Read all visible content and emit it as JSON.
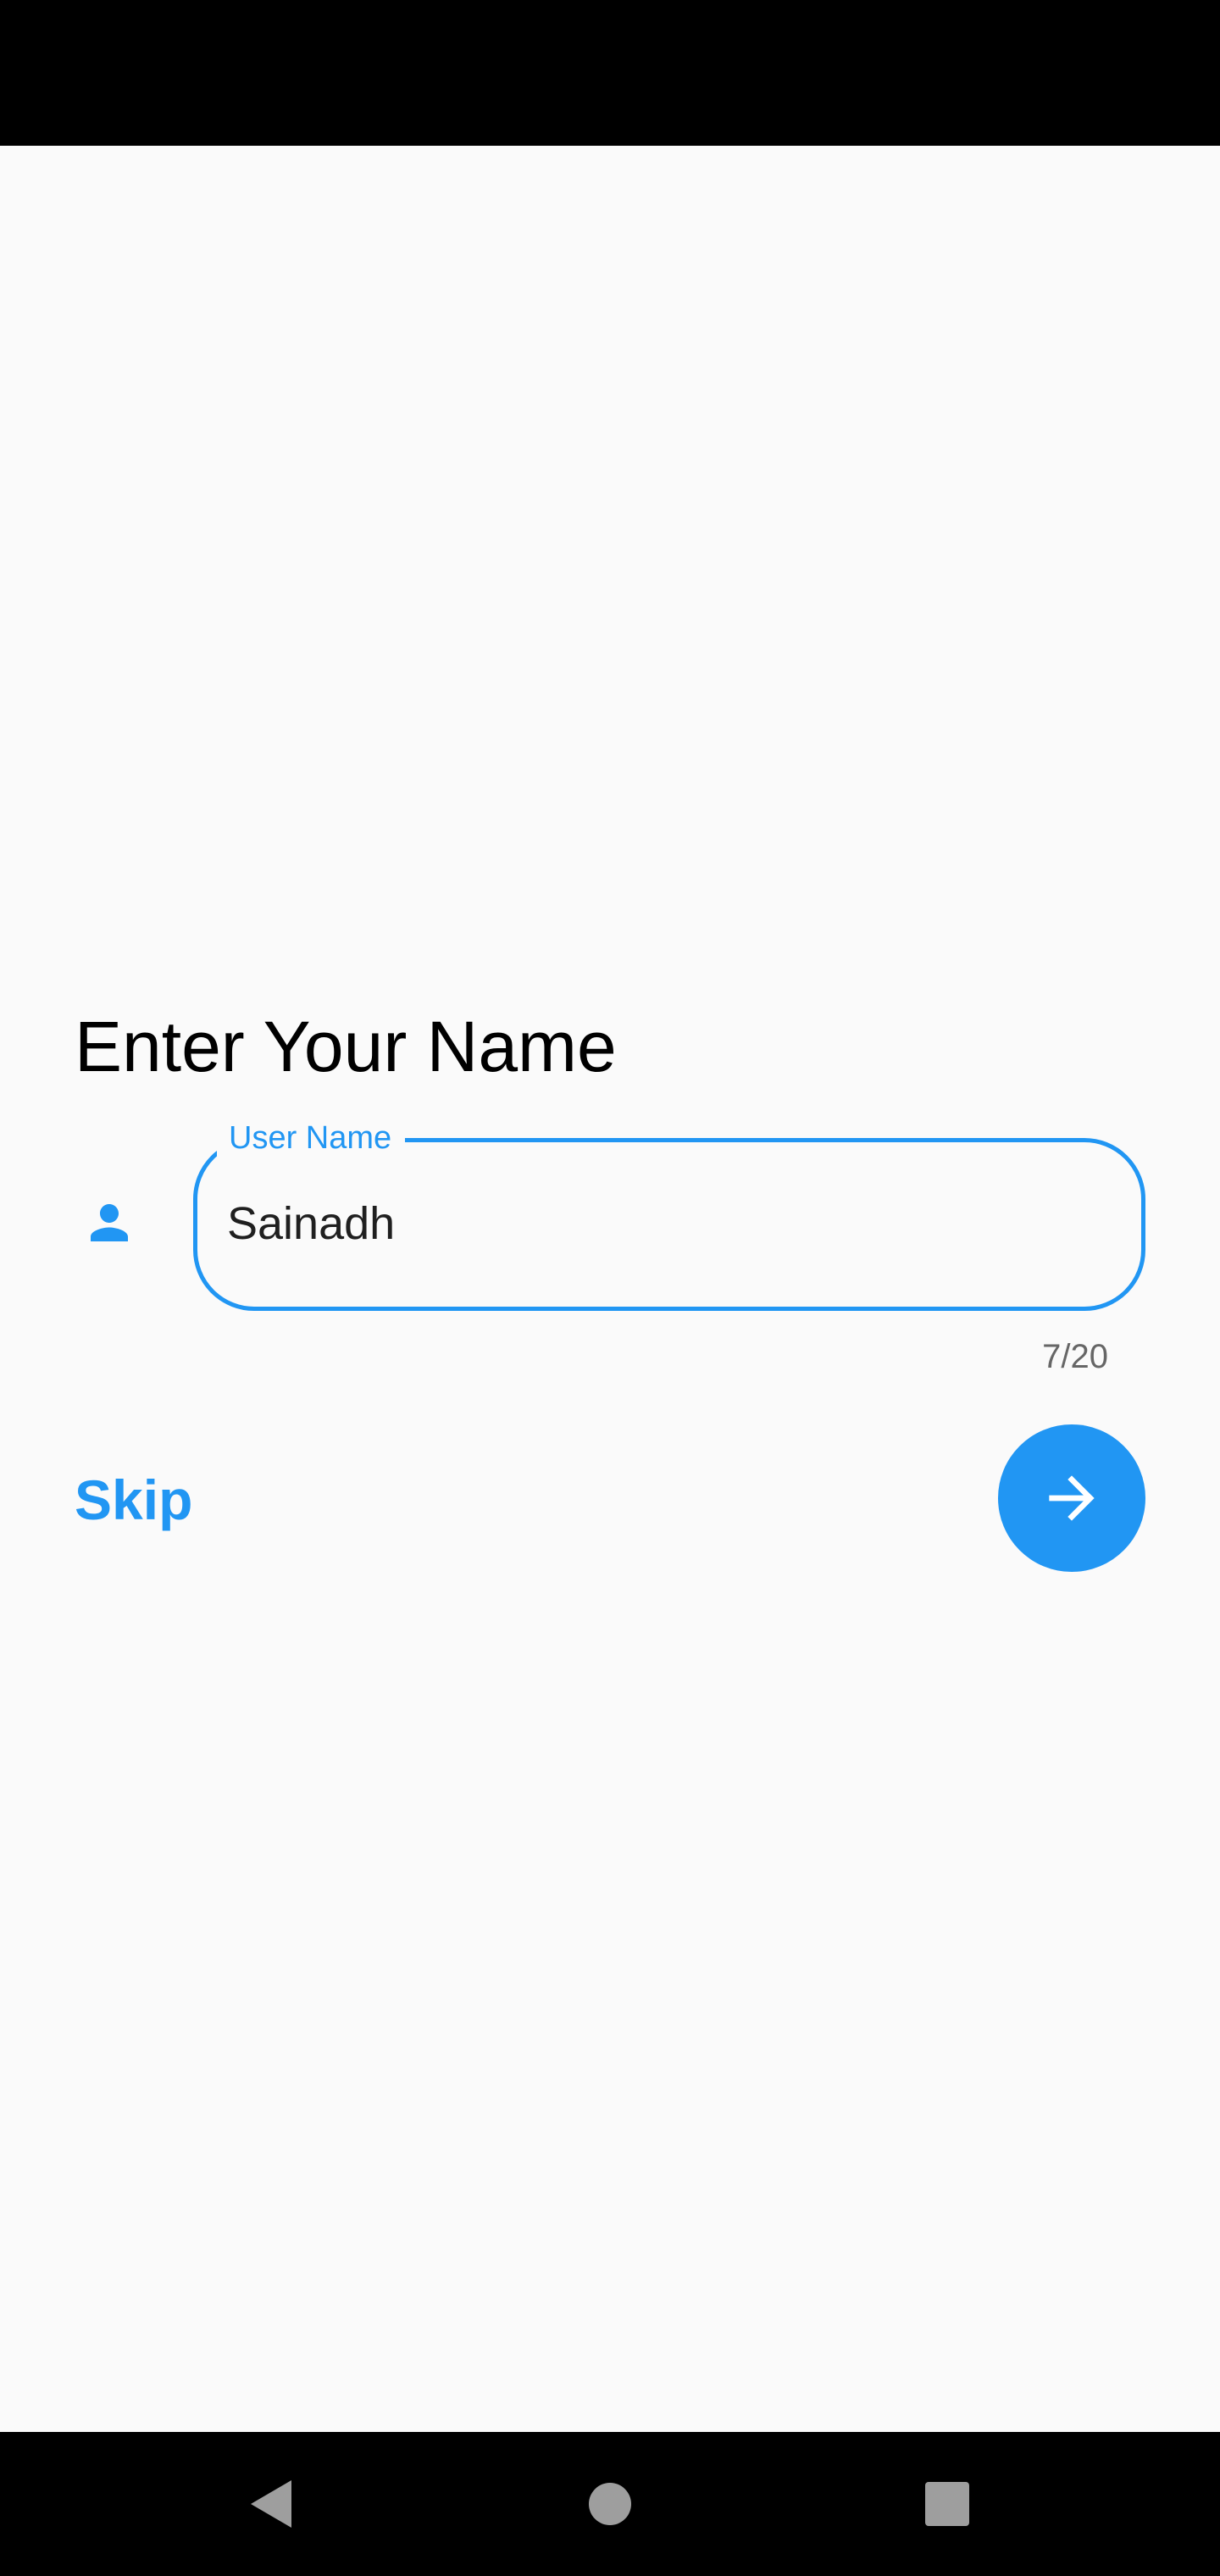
{
  "screen": {
    "title": "Enter Your Name",
    "name_field": {
      "label": "User Name",
      "value": "Sainadh",
      "counter": "7/20",
      "icon": "person-icon"
    },
    "skip_label": "Skip",
    "next_icon": "arrow-forward-icon"
  },
  "navigation_bar": {
    "back_icon": "back-triangle-icon",
    "home_icon": "home-circle-icon",
    "recents_icon": "recents-square-icon"
  },
  "colors": {
    "accent": "#2196f3",
    "background": "#fafafa",
    "system_bars": "#000000",
    "nav_icons": "#9e9e9e"
  }
}
